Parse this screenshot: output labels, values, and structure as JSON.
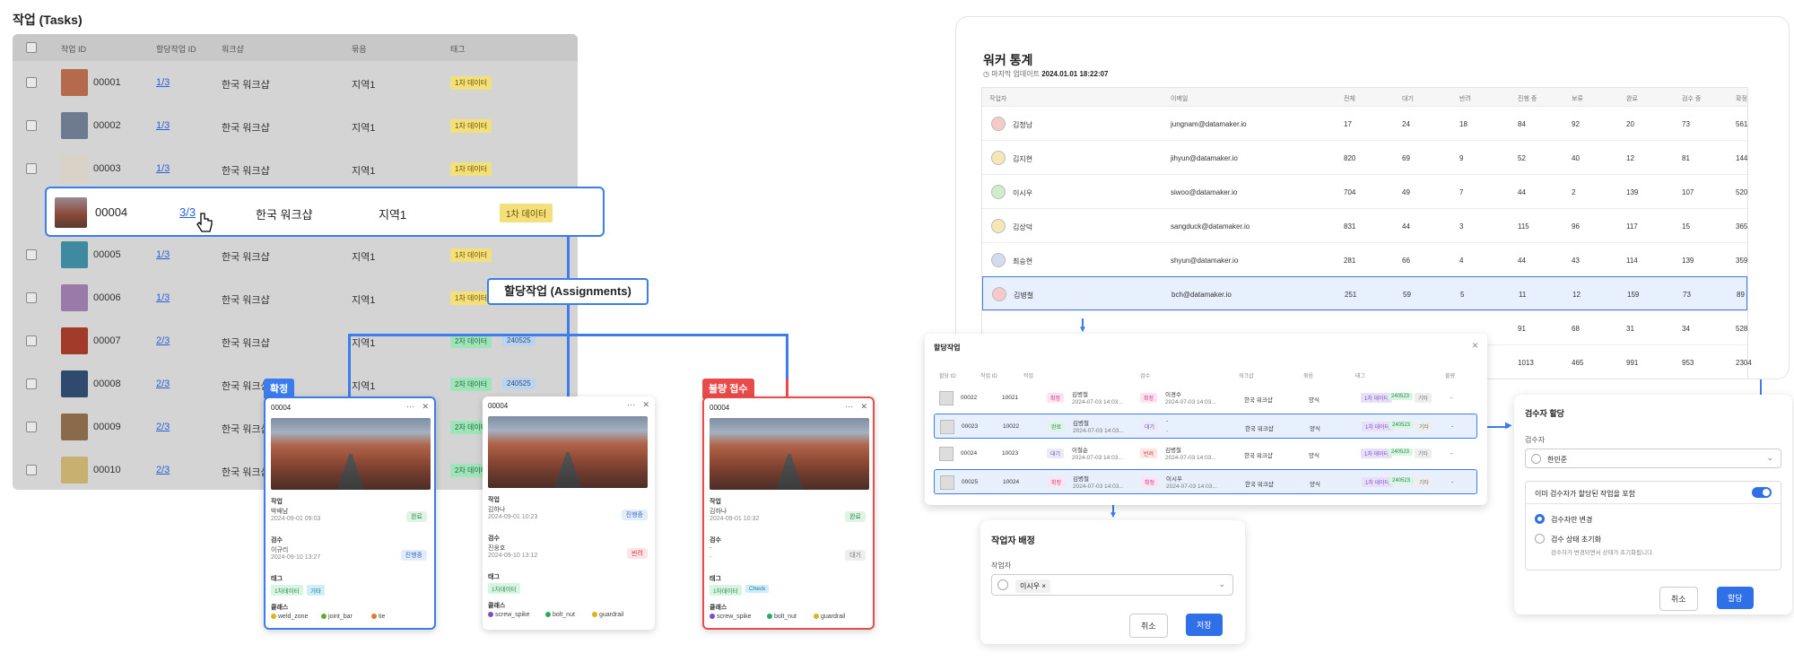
{
  "tasks": {
    "title": "작업 (Tasks)",
    "columns": [
      "작업 ID",
      "할당작업 ID",
      "워크샵",
      "묶음",
      "태그"
    ],
    "rows": [
      {
        "id": "00001",
        "assign": "1/3",
        "workshop": "한국 워크샵",
        "group": "지역1",
        "tags": [
          "1차 데이터"
        ],
        "thumb": "#b56a4e"
      },
      {
        "id": "00002",
        "assign": "1/3",
        "workshop": "한국 워크샵",
        "group": "지역1",
        "tags": [
          "1차 데이터"
        ],
        "thumb": "#6d7a90"
      },
      {
        "id": "00003",
        "assign": "1/3",
        "workshop": "한국 워크샵",
        "group": "지역1",
        "tags": [
          "1차 데이터"
        ],
        "thumb": "#d9d2c6"
      },
      {
        "id": "00004",
        "assign": "3/3",
        "workshop": "한국 워크샵",
        "group": "지역1",
        "tags": [
          "1차 데이터"
        ],
        "thumb": "#8a4a3a"
      },
      {
        "id": "00005",
        "assign": "1/3",
        "workshop": "한국 워크샵",
        "group": "지역1",
        "tags": [
          "1차 데이터"
        ],
        "thumb": "#3f8aa0"
      },
      {
        "id": "00006",
        "assign": "1/3",
        "workshop": "한국 워크샵",
        "group": "지역1",
        "tags": [
          "1차 데이터"
        ],
        "thumb": "#9a7aa8"
      },
      {
        "id": "00007",
        "assign": "2/3",
        "workshop": "한국 워크샵",
        "group": "지역1",
        "tags": [
          "2차 데이터",
          "240525"
        ],
        "thumb": "#a23a2a"
      },
      {
        "id": "00008",
        "assign": "2/3",
        "workshop": "한국 워크샵",
        "group": "지역1",
        "tags": [
          "2차 데이터",
          "240525"
        ],
        "thumb": "#304a6e"
      },
      {
        "id": "00009",
        "assign": "2/3",
        "workshop": "한국 워크샵",
        "group": "",
        "tags": [
          "2차 데이터"
        ],
        "thumb": "#8a6a4a"
      },
      {
        "id": "00010",
        "assign": "2/3",
        "workshop": "한국 워크샵",
        "group": "",
        "tags": [
          "2차 데이터"
        ],
        "thumb": "#c8b070"
      }
    ]
  },
  "assignments_label": "할당작업 (Assignments)",
  "cards": [
    {
      "badge": "확정",
      "id": "00004",
      "work_label": "작업",
      "worker": "박배남",
      "work_date": "2024-09-01 09:03",
      "work_status": "완료",
      "review_label": "검수",
      "reviewer": "이규리",
      "review_date": "2024-09-10 13:27",
      "review_status": "진행중",
      "tag_label": "태그",
      "tags": [
        "1차데이터",
        "기타"
      ],
      "class_label": "클래스",
      "classes": [
        "weld_zone",
        "joint_bar",
        "tie"
      ]
    },
    {
      "badge": "",
      "id": "00004",
      "work_label": "작업",
      "worker": "김하나",
      "work_date": "2024-09-01 10:23",
      "work_status": "진행중",
      "review_label": "검수",
      "reviewer": "진웅호",
      "review_date": "2024-09-10 13:12",
      "review_status": "반려",
      "tag_label": "태그",
      "tags": [
        "1차데이터"
      ],
      "class_label": "클래스",
      "classes": [
        "screw_spike",
        "bolt_nut",
        "guardrail"
      ]
    },
    {
      "badge": "불량 접수",
      "id": "00004",
      "work_label": "작업",
      "worker": "김하나",
      "work_date": "2024-09-01 10:32",
      "work_status": "완료",
      "review_label": "검수",
      "reviewer": "-",
      "review_date": "-",
      "review_status": "대기",
      "tag_label": "태그",
      "tags": [
        "1차데이터",
        "Check"
      ],
      "class_label": "클래스",
      "classes": [
        "screw_spike",
        "bolt_nut",
        "guardrail"
      ]
    }
  ],
  "worker_stats": {
    "title": "워커 통계",
    "updated_label": "마지막 업데이트",
    "updated_at": "2024.01.01 18:22:07",
    "columns": [
      "작업자",
      "이메일",
      "전체",
      "대기",
      "반려",
      "진행 중",
      "보류",
      "완료",
      "검수 중",
      "확정"
    ],
    "rows": [
      {
        "name": "김정남",
        "email": "jungnam@datamaker.io",
        "vals": [
          "17",
          "24",
          "18",
          "84",
          "92",
          "20",
          "73",
          "561"
        ]
      },
      {
        "name": "김지현",
        "email": "jihyun@datamaker.io",
        "vals": [
          "820",
          "69",
          "9",
          "52",
          "40",
          "12",
          "81",
          "144"
        ]
      },
      {
        "name": "이시우",
        "email": "siwoo@datamaker.io",
        "vals": [
          "704",
          "49",
          "7",
          "44",
          "2",
          "139",
          "107",
          "520"
        ]
      },
      {
        "name": "김상덕",
        "email": "sangduck@datamaker.io",
        "vals": [
          "831",
          "44",
          "3",
          "115",
          "96",
          "117",
          "15",
          "365"
        ]
      },
      {
        "name": "최승현",
        "email": "shyun@datamaker.io",
        "vals": [
          "281",
          "66",
          "4",
          "44",
          "43",
          "114",
          "139",
          "359"
        ]
      },
      {
        "name": "김병철",
        "email": "bch@datamaker.io",
        "vals": [
          "251",
          "59",
          "5",
          "11",
          "12",
          "159",
          "73",
          "89"
        ]
      },
      {
        "name": "",
        "email": "",
        "vals": [
          "",
          "",
          "",
          "91",
          "68",
          "31",
          "34",
          "528"
        ]
      },
      {
        "name": "",
        "email": "",
        "vals": [
          "",
          "",
          "",
          "1013",
          "465",
          "991",
          "953",
          "2304"
        ]
      }
    ]
  },
  "assign_panel": {
    "title": "할당작업",
    "columns": [
      "할당 ID",
      "작업 ID",
      "작업",
      "",
      "검수",
      "",
      "워크샵",
      "묶음",
      "태그",
      "불량"
    ],
    "rows": [
      {
        "aid": "00022",
        "tid": "10021",
        "wstatus": "확정",
        "worker": "김병철",
        "wdate": "2024-07-03 14:03...",
        "rstatus": "확정",
        "reviewer": "이경수",
        "rdate": "2024-07-03 14:03...",
        "workshop": "한국 워크샵",
        "group": "양식",
        "tags": [
          "1차 데이터",
          "240523",
          "기타"
        ],
        "defect": "-"
      },
      {
        "aid": "00023",
        "tid": "10022",
        "wstatus": "완료",
        "worker": "김병철",
        "wdate": "2024-07-03 14:03...",
        "rstatus": "대기",
        "reviewer": "-",
        "rdate": "-",
        "workshop": "한국 워크샵",
        "group": "양식",
        "tags": [
          "1차 데이터",
          "240523",
          "기타"
        ],
        "defect": "-"
      },
      {
        "aid": "00024",
        "tid": "10023",
        "wstatus": "대기",
        "worker": "이철순",
        "wdate": "2024-07-03 14:03...",
        "rstatus": "반려",
        "reviewer": "김병철",
        "rdate": "2024-07-03 14:03...",
        "workshop": "한국 워크샵",
        "group": "양식",
        "tags": [
          "1차 데이터",
          "240523",
          "기타"
        ],
        "defect": "-"
      },
      {
        "aid": "00025",
        "tid": "10024",
        "wstatus": "확정",
        "worker": "김병철",
        "wdate": "2024-07-03 14:03...",
        "rstatus": "확정",
        "reviewer": "이시우",
        "rdate": "2024-07-03 14:03...",
        "workshop": "한국 워크샵",
        "group": "양식",
        "tags": [
          "1차 데이터",
          "240523",
          "기타"
        ],
        "defect": "-"
      }
    ]
  },
  "worker_assign": {
    "title": "작업자 배정",
    "field_label": "작업자",
    "chip": "이시우",
    "cancel": "취소",
    "save": "저장"
  },
  "reviewer_assign": {
    "title": "검수자 할당",
    "field_label": "검수자",
    "selected": "한민준",
    "toggle_label": "이미 검수자가 할당된 작업을 포함",
    "opt1": "검수자만 변경",
    "opt2": "검수 상태 초기화",
    "opt2_desc": "검수자가 변경되면서 상태가 초기화됩니다.",
    "cancel": "취소",
    "confirm": "할당"
  }
}
